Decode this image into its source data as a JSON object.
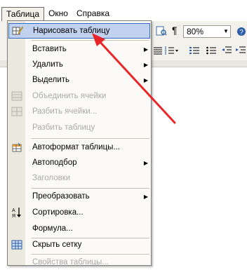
{
  "menubar": {
    "items": [
      "Таблица",
      "Окно",
      "Справка"
    ]
  },
  "toolbar": {
    "paragraph_glyph": "¶",
    "zoom_value": "80%"
  },
  "menu": {
    "items": [
      {
        "label": "Нарисовать таблицу",
        "enabled": true,
        "submenu": false,
        "icon": "pencil-table-icon",
        "highlighted": true
      },
      {
        "label": "Вставить",
        "enabled": true,
        "submenu": true
      },
      {
        "label": "Удалить",
        "enabled": true,
        "submenu": true
      },
      {
        "label": "Выделить",
        "enabled": true,
        "submenu": true
      },
      {
        "label": "Объединить ячейки",
        "enabled": false,
        "submenu": false,
        "icon": "merge-cells-icon"
      },
      {
        "label": "Разбить ячейки...",
        "enabled": false,
        "submenu": false,
        "icon": "split-cells-icon"
      },
      {
        "label": "Разбить таблицу",
        "enabled": false,
        "submenu": false
      },
      {
        "label": "Автоформат таблицы...",
        "enabled": true,
        "submenu": false,
        "icon": "autoformat-icon"
      },
      {
        "label": "Автоподбор",
        "enabled": true,
        "submenu": true
      },
      {
        "label": "Заголовки",
        "enabled": false,
        "submenu": false
      },
      {
        "label": "Преобразовать",
        "enabled": true,
        "submenu": true
      },
      {
        "label": "Сортировка...",
        "enabled": true,
        "submenu": false,
        "icon": "sort-az-icon"
      },
      {
        "label": "Формула...",
        "enabled": true,
        "submenu": false
      },
      {
        "label": "Скрыть сетку",
        "enabled": true,
        "submenu": false,
        "icon": "grid-icon"
      },
      {
        "label": "Свойства таблицы...",
        "enabled": false,
        "submenu": false
      }
    ]
  },
  "colors": {
    "highlight_fill": "#c1d2ee",
    "highlight_border": "#316ac5",
    "arrow": "#e8262a",
    "disabled_text": "#a9a9a9"
  }
}
